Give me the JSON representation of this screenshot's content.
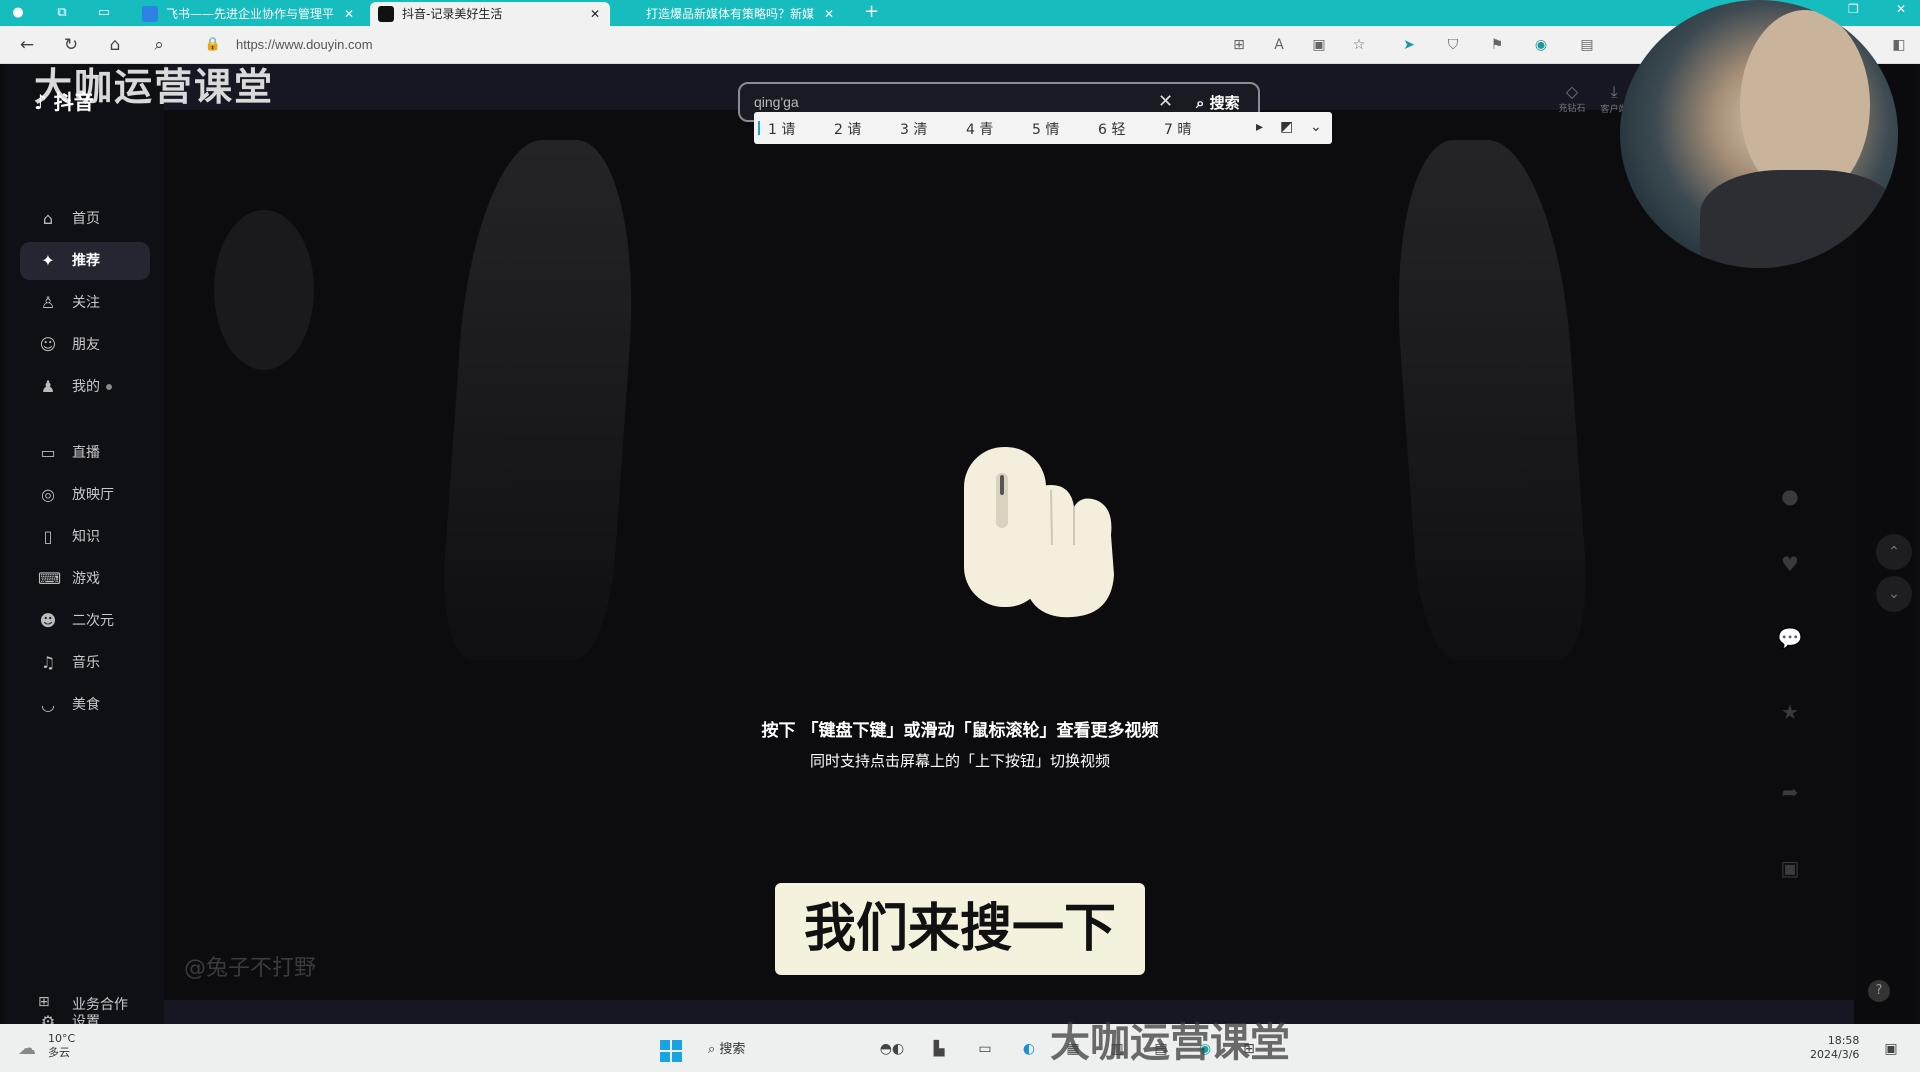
{
  "browser": {
    "tabs": [
      {
        "title": "飞书——先进企业协作与管理平",
        "active": false
      },
      {
        "title": "抖音-记录美好生活",
        "active": true
      },
      {
        "title": "打造爆品新媒体有策略吗？新媒",
        "active": false
      }
    ],
    "url": "https://www.douyin.com",
    "new_tab": "+"
  },
  "watermark": "大咖运营课堂",
  "logo": "抖音",
  "sidebar": {
    "items": [
      {
        "label": "首页",
        "icon": "home-icon"
      },
      {
        "label": "推荐",
        "icon": "sparkle-icon",
        "active": true
      },
      {
        "label": "关注",
        "icon": "follow-icon"
      },
      {
        "label": "朋友",
        "icon": "friends-icon"
      },
      {
        "label": "我的",
        "icon": "user-icon"
      },
      {
        "label": "直播",
        "icon": "live-icon"
      },
      {
        "label": "放映厅",
        "icon": "cinema-icon"
      },
      {
        "label": "知识",
        "icon": "knowledge-icon"
      },
      {
        "label": "游戏",
        "icon": "game-icon"
      },
      {
        "label": "二次元",
        "icon": "anime-icon"
      },
      {
        "label": "音乐",
        "icon": "music-icon"
      },
      {
        "label": "美食",
        "icon": "food-icon"
      }
    ],
    "bottom": [
      {
        "label": "设置",
        "icon": "gear-icon"
      },
      {
        "label": "业务合作",
        "icon": "grid-icon"
      }
    ]
  },
  "search": {
    "value": "qing'ga",
    "button": "搜索",
    "ime_candidates": [
      "1 请",
      "2 请",
      "3 清",
      "4 青",
      "5 情",
      "6 轻",
      "7 晴"
    ]
  },
  "top_right": {
    "items": [
      "充钻石",
      "客户端"
    ]
  },
  "video": {
    "hint_main": "按下 「键盘下键」或滑动「鼠标滚轮」查看更多视频",
    "hint_sub": "同时支持点击屏幕上的「上下按钮」切换视频",
    "author": "@兔子不打野",
    "subtitle": "我们来搜一下"
  },
  "taskbar": {
    "weather_temp": "10°C",
    "weather_desc": "多云",
    "search_label": "搜索",
    "time": "18:58",
    "date": "2024/3/6"
  },
  "colors": {
    "browser_accent": "#17bcbf",
    "page_bg": "#161722"
  }
}
